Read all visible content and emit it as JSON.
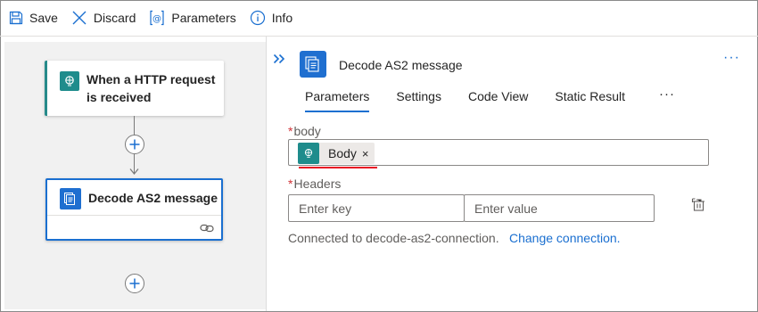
{
  "toolbar": {
    "save_label": "Save",
    "discard_label": "Discard",
    "parameters_label": "Parameters",
    "info_label": "Info"
  },
  "designer": {
    "trigger_title": "When a HTTP request is received",
    "action_title": "Decode AS2 message"
  },
  "panel": {
    "title": "Decode AS2 message",
    "tabs": [
      "Parameters",
      "Settings",
      "Code View",
      "Static Result"
    ],
    "active_tab": "Parameters",
    "more": "···",
    "overflow": "···"
  },
  "fields": {
    "body_label": "body",
    "body_token": "Body",
    "body_token_remove": "×",
    "headers_label": "Headers",
    "required_mark": "*",
    "key_placeholder": "Enter key",
    "value_placeholder": "Enter value"
  },
  "connection": {
    "text": "Connected to decode-as2-connection.",
    "link": "Change connection."
  },
  "colors": {
    "accent": "#1a6fd0",
    "trigger": "#1f8c8c",
    "required": "#d13438",
    "error_underline": "#e81123"
  },
  "icons": [
    "save-icon",
    "discard-icon",
    "parameters-icon",
    "info-icon",
    "http-request-icon",
    "as2-icon",
    "link-icon",
    "plus-icon",
    "double-chevron-icon",
    "delete-row-icon"
  ]
}
